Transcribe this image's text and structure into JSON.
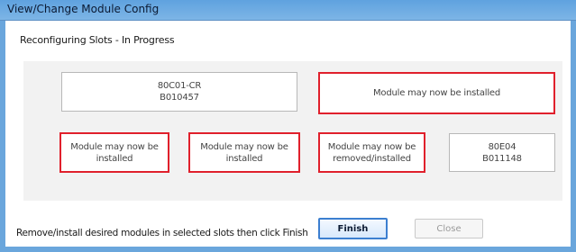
{
  "window": {
    "title": "View/Change Module Config"
  },
  "status": {
    "text": "Reconfiguring Slots - In Progress"
  },
  "slots": [
    {
      "line1": "80C01-CR",
      "line2": "B010457"
    },
    {
      "line1": "Module may now be installed",
      "line2": ""
    },
    {
      "line1": "Module may now be",
      "line2": "installed"
    },
    {
      "line1": "Module may now be",
      "line2": "installed"
    },
    {
      "line1": "Module may now be",
      "line2": "removed/installed"
    },
    {
      "line1": "80E04",
      "line2": "B011148"
    }
  ],
  "footer": {
    "instruction": "Remove/install desired modules in selected slots then click Finish",
    "finish_label": "Finish",
    "close_label": "Close"
  },
  "colors": {
    "highlight_border": "#e0202c",
    "title_bar": "#6aa6dc"
  }
}
